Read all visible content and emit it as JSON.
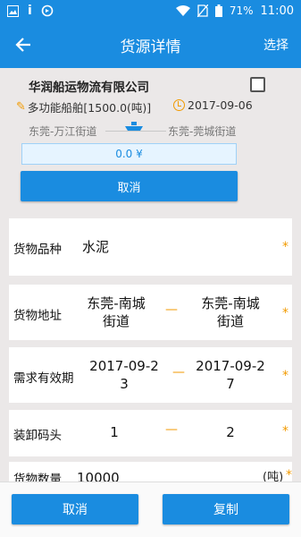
{
  "status_bar": {
    "battery": "71%",
    "time": "11:00",
    "icons": [
      "image-icon",
      "info-icon",
      "sync-icon",
      "wifi-icon",
      "no-sim-icon",
      "battery-icon"
    ]
  },
  "app_bar": {
    "title": "货源详情",
    "action": "选择",
    "back_icon": "arrow-left-icon"
  },
  "card": {
    "company": "华润船运物流有限公司",
    "ship_type": "多功能船舶[1500.0(吨)]",
    "date": "2017-09-06",
    "route_from": "东莞-万江街道",
    "route_to": "东莞-莞城街道",
    "price": "0.0 ¥",
    "cancel": "取消"
  },
  "form": {
    "cargo_type": {
      "label": "货物品种",
      "value": "水泥"
    },
    "cargo_address": {
      "label": "货物地址",
      "from": "东莞-南城街道",
      "to": "东莞-南城街道"
    },
    "validity": {
      "label": "需求有效期",
      "from": "2017-09-23",
      "to": "2017-09-27"
    },
    "dock": {
      "label": "装卸码头",
      "from": "1",
      "to": "2"
    },
    "quantity": {
      "label": "货物数量",
      "value": "10000",
      "unit": "(吨)"
    },
    "required_mark": "*",
    "range_separator": "—"
  },
  "bottom": {
    "cancel": "取消",
    "copy": "复制"
  },
  "colors": {
    "primary": "#1a8ce0",
    "accent": "#f29a00"
  }
}
